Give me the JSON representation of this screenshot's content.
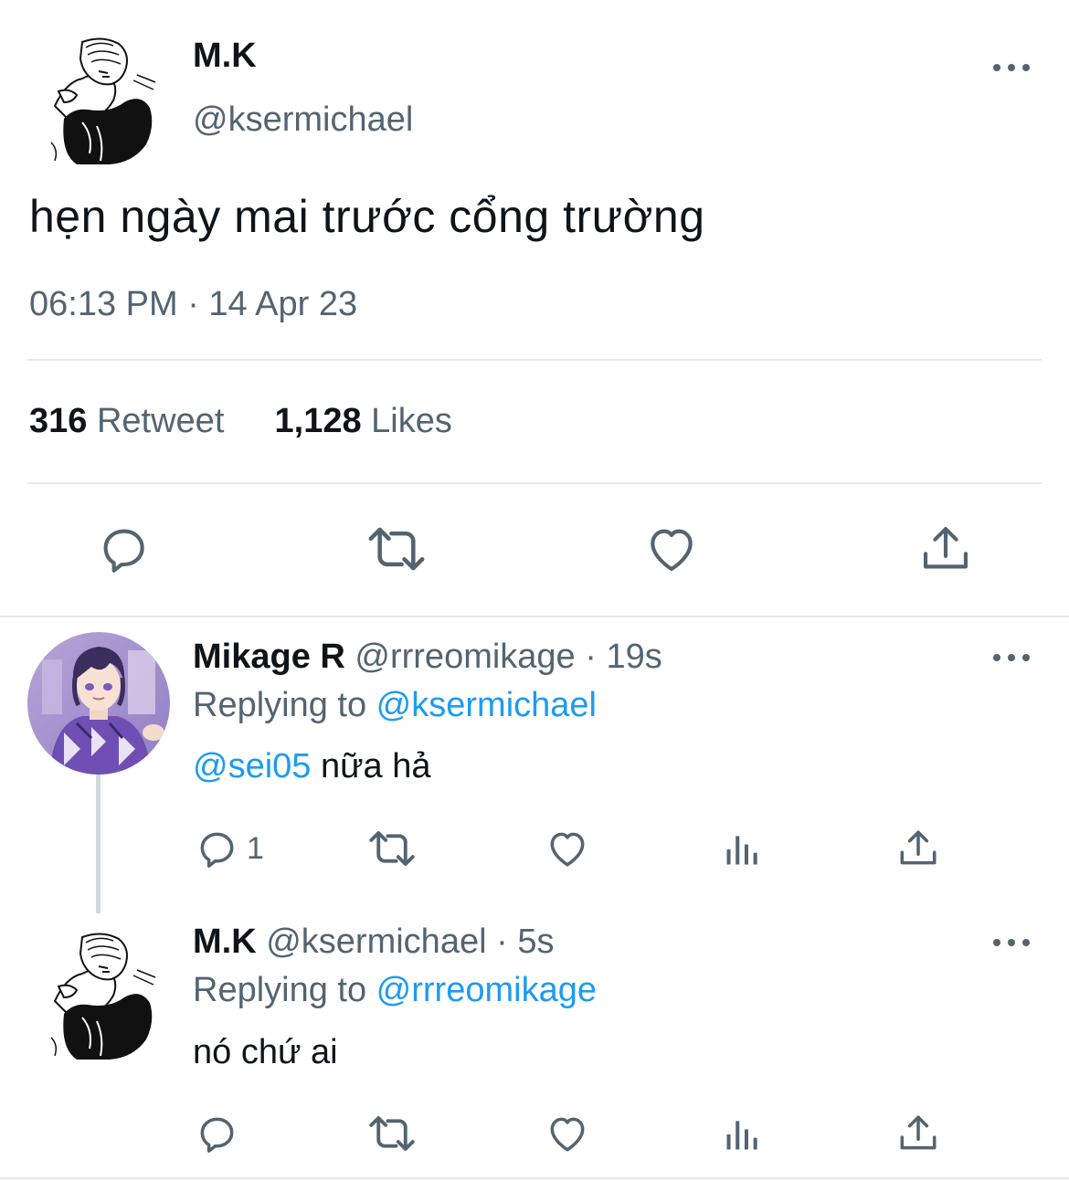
{
  "main_tweet": {
    "display_name": "M.K",
    "handle": "@ksermichael",
    "text": "hẹn ngày mai trước cổng trường",
    "timestamp": "06:13 PM · 14 Apr 23",
    "retweet_count": "316",
    "retweet_label": "Retweet",
    "like_count": "1,128",
    "like_label": "Likes",
    "actions": [
      "reply-icon",
      "retweet-icon",
      "like-icon",
      "share-icon"
    ]
  },
  "replies": [
    {
      "display_name": "Mikage R",
      "handle": "@rrreomikage",
      "separator": " · ",
      "time": "19s",
      "replying_prefix": "Replying to ",
      "replying_to": "@ksermichael",
      "mention": "@sei05",
      "text": " nữa hả",
      "reply_count": "1",
      "actions": [
        "reply-icon",
        "retweet-icon",
        "like-icon",
        "analytics-icon",
        "share-icon"
      ]
    },
    {
      "display_name": "M.K",
      "handle": "@ksermichael",
      "separator": " · ",
      "time": "5s",
      "replying_prefix": "Replying to ",
      "replying_to": "@rrreomikage",
      "text": "nó chứ ai",
      "actions": [
        "reply-icon",
        "retweet-icon",
        "like-icon",
        "analytics-icon",
        "share-icon"
      ]
    }
  ],
  "colors": {
    "text_primary": "#0f1419",
    "text_secondary": "#536471",
    "link": "#1d9bf0",
    "divider": "#e6e9eb"
  }
}
